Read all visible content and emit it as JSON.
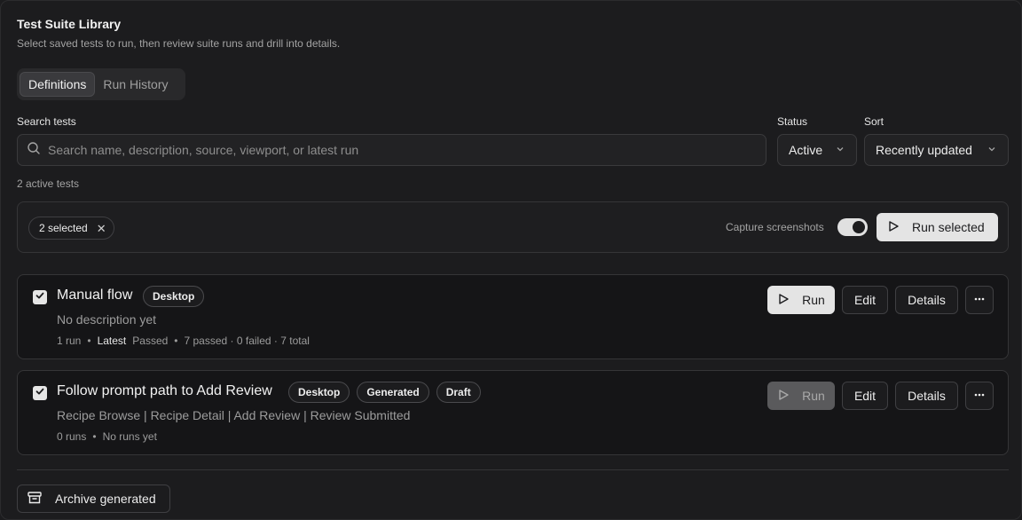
{
  "header": {
    "title": "Test Suite Library",
    "subtitle": "Select saved tests to run, then review suite runs and drill into details."
  },
  "tabs": [
    {
      "label": "Definitions",
      "active": true
    },
    {
      "label": "Run History",
      "active": false
    }
  ],
  "search": {
    "label": "Search tests",
    "placeholder": "Search name, description, source, viewport, or latest run",
    "value": ""
  },
  "filters": {
    "status_label": "Status",
    "status_value": "Active",
    "sort_label": "Sort",
    "sort_value": "Recently updated"
  },
  "count_text": "2 active tests",
  "selection": {
    "chip_label": "2 selected",
    "capture_label": "Capture screenshots",
    "capture_enabled": true,
    "run_selected_label": "Run selected"
  },
  "tests": [
    {
      "title": "Manual flow",
      "badges": [
        "Desktop"
      ],
      "description": "No description yet",
      "checked": true,
      "meta": {
        "runs": "1 run",
        "latest_label": "Latest",
        "latest_status": "Passed",
        "summary": "7 passed · 0 failed · 7 total"
      },
      "run_disabled": false
    },
    {
      "title": "Follow prompt path to Add Review",
      "badges": [
        "Desktop",
        "Generated",
        "Draft"
      ],
      "description": "Recipe Browse | Recipe Detail | Add Review | Review Submitted",
      "checked": true,
      "meta": {
        "runs": "0 runs",
        "summary": "No runs yet"
      },
      "run_disabled": true
    }
  ],
  "actions": {
    "run_label": "Run",
    "edit_label": "Edit",
    "details_label": "Details",
    "meta_separator": "•"
  },
  "archive_label": "Archive generated",
  "icons": {
    "search": "search-icon",
    "chevron": "chevron-down-icon",
    "play": "play-icon",
    "check": "check-icon",
    "more": "more-horizontal-icon",
    "archive": "archive-icon",
    "close": "close-icon"
  }
}
